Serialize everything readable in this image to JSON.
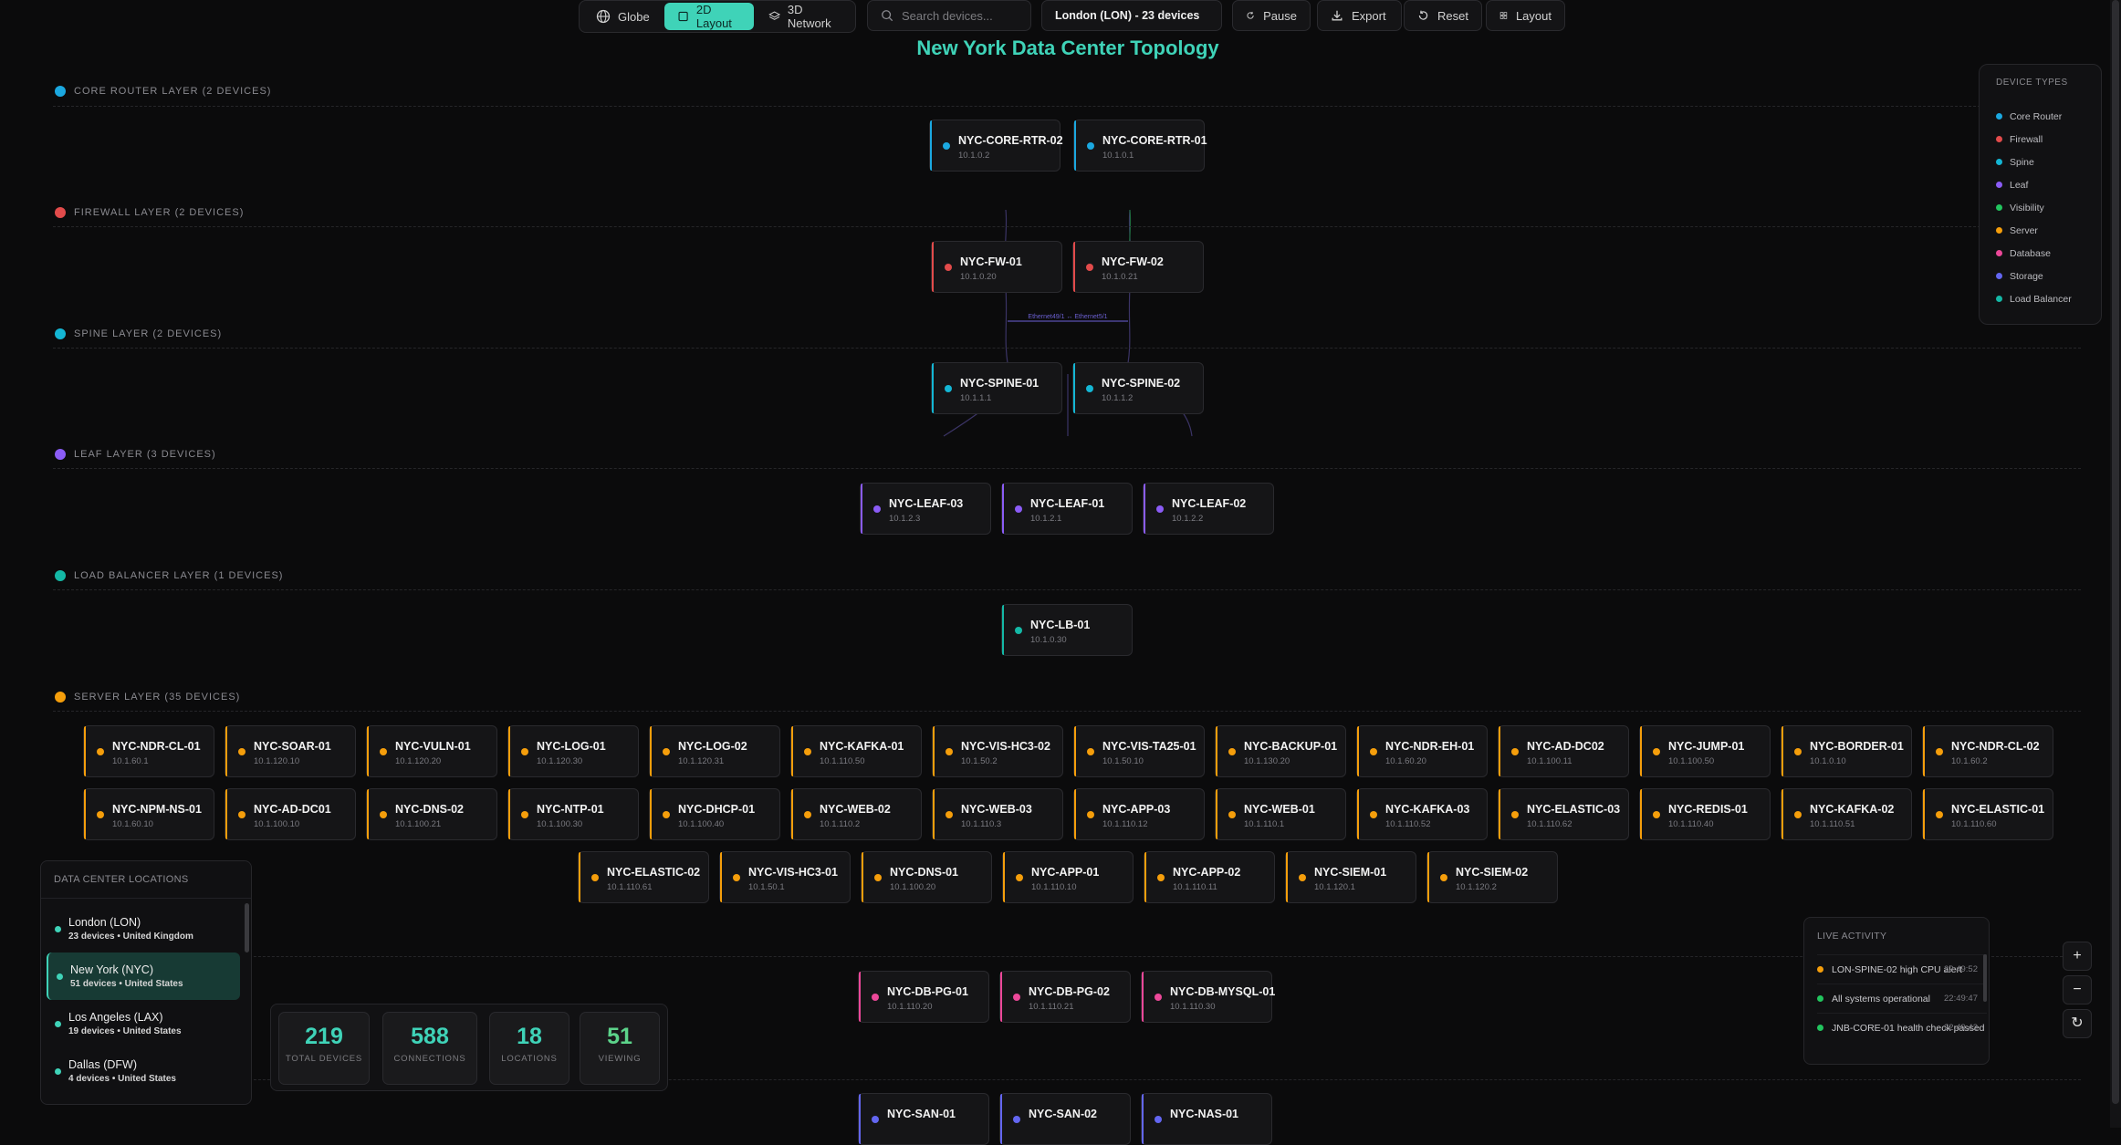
{
  "toolbar": {
    "view_buttons": [
      "Globe",
      "2D Layout",
      "3D Network"
    ],
    "search_placeholder": "Search devices...",
    "location_select": "London (LON) - 23 devices",
    "pause": "Pause",
    "export": "Export",
    "reset": "Reset",
    "layout": "Layout"
  },
  "page_title": "New York Data Center Topology",
  "colors": {
    "accent": "#3fd3b8",
    "core_router": "#1ba8e0",
    "firewall": "#e24b4b",
    "spine": "#14b6d4",
    "leaf": "#8b5cf6",
    "visibility": "#22c55e",
    "server": "#f59e0b",
    "database": "#ec4899",
    "storage": "#6366f1",
    "load_balancer": "#14b8a6"
  },
  "layers": {
    "core": "CORE ROUTER LAYER (2 DEVICES)",
    "firewall": "FIREWALL LAYER (2 DEVICES)",
    "spine": "SPINE LAYER (2 DEVICES)",
    "leaf": "LEAF LAYER (3 DEVICES)",
    "lb": "LOAD BALANCER LAYER (1 DEVICES)",
    "server": "SERVER LAYER (35 DEVICES)"
  },
  "link_label": "Ethernet49/1 ↔ Ethernet5/1",
  "devices": {
    "core": [
      {
        "name": "NYC-CORE-RTR-02",
        "ip": "10.1.0.2"
      },
      {
        "name": "NYC-CORE-RTR-01",
        "ip": "10.1.0.1"
      }
    ],
    "firewall": [
      {
        "name": "NYC-FW-01",
        "ip": "10.1.0.20"
      },
      {
        "name": "NYC-FW-02",
        "ip": "10.1.0.21"
      }
    ],
    "spine": [
      {
        "name": "NYC-SPINE-01",
        "ip": "10.1.1.1"
      },
      {
        "name": "NYC-SPINE-02",
        "ip": "10.1.1.2"
      }
    ],
    "leaf": [
      {
        "name": "NYC-LEAF-03",
        "ip": "10.1.2.3"
      },
      {
        "name": "NYC-LEAF-01",
        "ip": "10.1.2.1"
      },
      {
        "name": "NYC-LEAF-02",
        "ip": "10.1.2.2"
      }
    ],
    "lb": [
      {
        "name": "NYC-LB-01",
        "ip": "10.1.0.30"
      }
    ],
    "server_row1": [
      {
        "name": "NYC-NDR-CL-01",
        "ip": "10.1.60.1"
      },
      {
        "name": "NYC-SOAR-01",
        "ip": "10.1.120.10"
      },
      {
        "name": "NYC-VULN-01",
        "ip": "10.1.120.20"
      },
      {
        "name": "NYC-LOG-01",
        "ip": "10.1.120.30"
      },
      {
        "name": "NYC-LOG-02",
        "ip": "10.1.120.31"
      },
      {
        "name": "NYC-KAFKA-01",
        "ip": "10.1.110.50"
      },
      {
        "name": "NYC-VIS-HC3-02",
        "ip": "10.1.50.2"
      },
      {
        "name": "NYC-VIS-TA25-01",
        "ip": "10.1.50.10"
      },
      {
        "name": "NYC-BACKUP-01",
        "ip": "10.1.130.20"
      },
      {
        "name": "NYC-NDR-EH-01",
        "ip": "10.1.60.20"
      },
      {
        "name": "NYC-AD-DC02",
        "ip": "10.1.100.11"
      },
      {
        "name": "NYC-JUMP-01",
        "ip": "10.1.100.50"
      },
      {
        "name": "NYC-BORDER-01",
        "ip": "10.1.0.10"
      },
      {
        "name": "NYC-NDR-CL-02",
        "ip": "10.1.60.2"
      }
    ],
    "server_row2": [
      {
        "name": "NYC-NPM-NS-01",
        "ip": "10.1.60.10"
      },
      {
        "name": "NYC-AD-DC01",
        "ip": "10.1.100.10"
      },
      {
        "name": "NYC-DNS-02",
        "ip": "10.1.100.21"
      },
      {
        "name": "NYC-NTP-01",
        "ip": "10.1.100.30"
      },
      {
        "name": "NYC-DHCP-01",
        "ip": "10.1.100.40"
      },
      {
        "name": "NYC-WEB-02",
        "ip": "10.1.110.2"
      },
      {
        "name": "NYC-WEB-03",
        "ip": "10.1.110.3"
      },
      {
        "name": "NYC-APP-03",
        "ip": "10.1.110.12"
      },
      {
        "name": "NYC-WEB-01",
        "ip": "10.1.110.1"
      },
      {
        "name": "NYC-KAFKA-03",
        "ip": "10.1.110.52"
      },
      {
        "name": "NYC-ELASTIC-03",
        "ip": "10.1.110.62"
      },
      {
        "name": "NYC-REDIS-01",
        "ip": "10.1.110.40"
      },
      {
        "name": "NYC-KAFKA-02",
        "ip": "10.1.110.51"
      },
      {
        "name": "NYC-ELASTIC-01",
        "ip": "10.1.110.60"
      }
    ],
    "server_row3": [
      {
        "name": "NYC-ELASTIC-02",
        "ip": "10.1.110.61"
      },
      {
        "name": "NYC-VIS-HC3-01",
        "ip": "10.1.50.1"
      },
      {
        "name": "NYC-DNS-01",
        "ip": "10.1.100.20"
      },
      {
        "name": "NYC-APP-01",
        "ip": "10.1.110.10"
      },
      {
        "name": "NYC-APP-02",
        "ip": "10.1.110.11"
      },
      {
        "name": "NYC-SIEM-01",
        "ip": "10.1.120.1"
      },
      {
        "name": "NYC-SIEM-02",
        "ip": "10.1.120.2"
      }
    ],
    "database": [
      {
        "name": "NYC-DB-PG-01",
        "ip": "10.1.110.20"
      },
      {
        "name": "NYC-DB-PG-02",
        "ip": "10.1.110.21"
      },
      {
        "name": "NYC-DB-MYSQL-01",
        "ip": "10.1.110.30"
      }
    ],
    "storage": [
      {
        "name": "NYC-SAN-01",
        "ip": ""
      },
      {
        "name": "NYC-SAN-02",
        "ip": ""
      },
      {
        "name": "NYC-NAS-01",
        "ip": ""
      }
    ]
  },
  "legend": {
    "title": "DEVICE TYPES",
    "items": [
      {
        "label": "Core Router",
        "color": "#1ba8e0"
      },
      {
        "label": "Firewall",
        "color": "#e24b4b"
      },
      {
        "label": "Spine",
        "color": "#14b6d4"
      },
      {
        "label": "Leaf",
        "color": "#8b5cf6"
      },
      {
        "label": "Visibility",
        "color": "#22c55e"
      },
      {
        "label": "Server",
        "color": "#f59e0b"
      },
      {
        "label": "Database",
        "color": "#ec4899"
      },
      {
        "label": "Storage",
        "color": "#6366f1"
      },
      {
        "label": "Load Balancer",
        "color": "#14b8a6"
      }
    ]
  },
  "locations": {
    "title": "DATA CENTER LOCATIONS",
    "items": [
      {
        "name": "London (LON)",
        "sub": "23 devices • United Kingdom"
      },
      {
        "name": "New York (NYC)",
        "sub": "51 devices • United States"
      },
      {
        "name": "Los Angeles (LAX)",
        "sub": "19 devices • United States"
      },
      {
        "name": "Dallas (DFW)",
        "sub": "4 devices • United States"
      }
    ]
  },
  "stats": [
    {
      "value": "219",
      "label": "TOTAL DEVICES"
    },
    {
      "value": "588",
      "label": "CONNECTIONS"
    },
    {
      "value": "18",
      "label": "LOCATIONS"
    },
    {
      "value": "51",
      "label": "VIEWING"
    }
  ],
  "activity": {
    "title": "LIVE ACTIVITY",
    "items": [
      {
        "msg": "LON-SPINE-02 high CPU alert",
        "time": "22:49:52",
        "color": "#f59e0b"
      },
      {
        "msg": "All systems operational",
        "time": "22:49:47",
        "color": "#22c55e"
      },
      {
        "msg": "JNB-CORE-01 health check passed",
        "time": "22:49:42",
        "color": "#22c55e"
      }
    ]
  },
  "zoom": {
    "in": "+",
    "out": "−",
    "reset": "↻"
  }
}
